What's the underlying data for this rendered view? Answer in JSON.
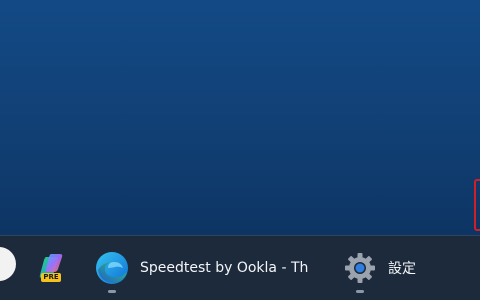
{
  "taskbar": {
    "apps": [
      {
        "name": "start",
        "label": ""
      },
      {
        "name": "copilot-pre",
        "badge": "PRE",
        "icon": "copilot-icon"
      },
      {
        "name": "edge",
        "title": "Speedtest by Ookla - Th",
        "icon": "edge-icon"
      },
      {
        "name": "settings",
        "title": "設定",
        "icon": "gear-icon"
      }
    ]
  },
  "colors": {
    "desktop_top": "#134a85",
    "desktop_bottom": "#0c3059",
    "taskbar_bg": "#1d2a3c",
    "accent_red": "#d11f2a"
  }
}
